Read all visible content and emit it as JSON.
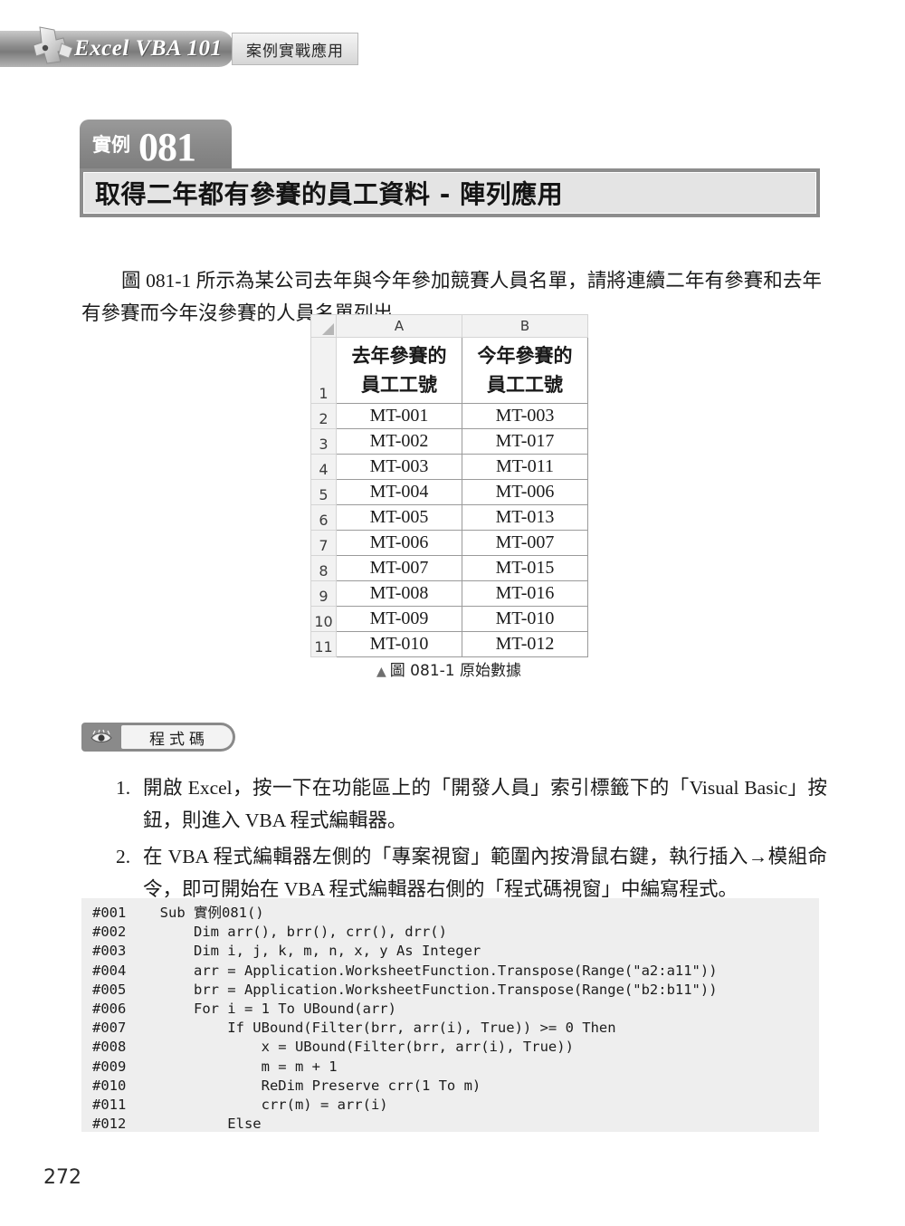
{
  "header": {
    "title": "Excel VBA 101",
    "subtitle": "案例實戰應用",
    "logo_icon": "puzzle-piece-icon"
  },
  "example": {
    "badge_label": "實例",
    "badge_number": "081",
    "title": "取得二年都有參賽的員工資料 - 陣列應用"
  },
  "intro": {
    "paragraph": "圖 081-1 所示為某公司去年與今年參加競賽人員名單，請將連續二年有參賽和去年有參賽而今年沒參賽的人員名單列出。"
  },
  "figure": {
    "caption_marker": "▲",
    "caption": "圖 081-1 原始數據",
    "corner_icon": "select-all-corner-icon",
    "column_headers": [
      "A",
      "B"
    ],
    "row_numbers": [
      "1",
      "2",
      "3",
      "4",
      "5",
      "6",
      "7",
      "8",
      "9",
      "10",
      "11"
    ],
    "table_header": {
      "a": "去年參賽的\n員工工號",
      "b": "今年參賽的\n員工工號",
      "a_line1": "去年參賽的",
      "a_line2": "員工工號",
      "b_line1": "今年參賽的",
      "b_line2": "員工工號"
    },
    "rows": [
      {
        "num": "2",
        "a": "MT-001",
        "b": "MT-003"
      },
      {
        "num": "3",
        "a": "MT-002",
        "b": "MT-017"
      },
      {
        "num": "4",
        "a": "MT-003",
        "b": "MT-011"
      },
      {
        "num": "5",
        "a": "MT-004",
        "b": "MT-006"
      },
      {
        "num": "6",
        "a": "MT-005",
        "b": "MT-013"
      },
      {
        "num": "7",
        "a": "MT-006",
        "b": "MT-007"
      },
      {
        "num": "8",
        "a": "MT-007",
        "b": "MT-015"
      },
      {
        "num": "9",
        "a": "MT-008",
        "b": "MT-016"
      },
      {
        "num": "10",
        "a": "MT-009",
        "b": "MT-010"
      },
      {
        "num": "11",
        "a": "MT-010",
        "b": "MT-012"
      }
    ]
  },
  "section": {
    "icon": "eye-icon",
    "label": "程式碼"
  },
  "steps": [
    {
      "num": "1.",
      "text": "開啟 Excel，按一下在功能區上的「開發人員」索引標籤下的「Visual Basic」按鈕，則進入 VBA 程式編輯器。"
    },
    {
      "num": "2.",
      "text": "在 VBA 程式編輯器左側的「專案視窗」範圍內按滑鼠右鍵，執行插入→模組命令，即可開始在 VBA 程式編輯器右側的「程式碼視窗」中編寫程式。"
    }
  ],
  "code": {
    "lines": [
      {
        "no": "#001",
        "text": "    Sub 實例081()"
      },
      {
        "no": "#002",
        "text": "        Dim arr(), brr(), crr(), drr()"
      },
      {
        "no": "#003",
        "text": "        Dim i, j, k, m, n, x, y As Integer"
      },
      {
        "no": "#004",
        "text": "        arr = Application.WorksheetFunction.Transpose(Range(\"a2:a11\"))"
      },
      {
        "no": "#005",
        "text": "        brr = Application.WorksheetFunction.Transpose(Range(\"b2:b11\"))"
      },
      {
        "no": "#006",
        "text": "        For i = 1 To UBound(arr)"
      },
      {
        "no": "#007",
        "text": "            If UBound(Filter(brr, arr(i), True)) >= 0 Then"
      },
      {
        "no": "#008",
        "text": "                x = UBound(Filter(brr, arr(i), True))"
      },
      {
        "no": "#009",
        "text": "                m = m + 1"
      },
      {
        "no": "#010",
        "text": "                ReDim Preserve crr(1 To m)"
      },
      {
        "no": "#011",
        "text": "                crr(m) = arr(i)"
      },
      {
        "no": "#012",
        "text": "            Else"
      }
    ]
  },
  "page_number": "272"
}
